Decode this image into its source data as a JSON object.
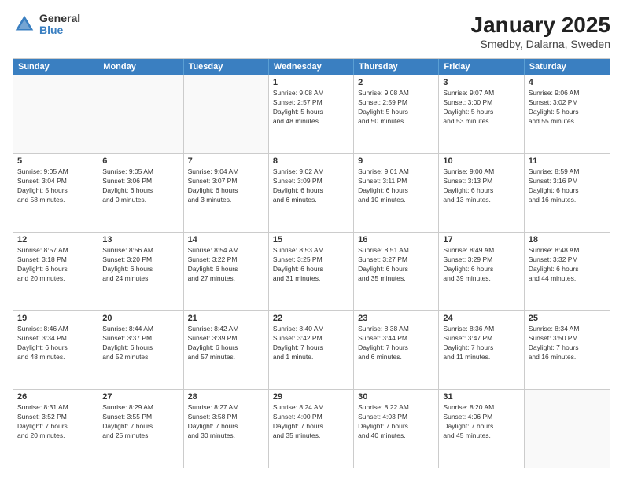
{
  "header": {
    "logo_general": "General",
    "logo_blue": "Blue",
    "month_title": "January 2025",
    "location": "Smedby, Dalarna, Sweden"
  },
  "weekdays": [
    "Sunday",
    "Monday",
    "Tuesday",
    "Wednesday",
    "Thursday",
    "Friday",
    "Saturday"
  ],
  "rows": [
    [
      {
        "day": "",
        "info": "",
        "empty": true
      },
      {
        "day": "",
        "info": "",
        "empty": true
      },
      {
        "day": "",
        "info": "",
        "empty": true
      },
      {
        "day": "1",
        "info": "Sunrise: 9:08 AM\nSunset: 2:57 PM\nDaylight: 5 hours\nand 48 minutes."
      },
      {
        "day": "2",
        "info": "Sunrise: 9:08 AM\nSunset: 2:59 PM\nDaylight: 5 hours\nand 50 minutes."
      },
      {
        "day": "3",
        "info": "Sunrise: 9:07 AM\nSunset: 3:00 PM\nDaylight: 5 hours\nand 53 minutes."
      },
      {
        "day": "4",
        "info": "Sunrise: 9:06 AM\nSunset: 3:02 PM\nDaylight: 5 hours\nand 55 minutes."
      }
    ],
    [
      {
        "day": "5",
        "info": "Sunrise: 9:05 AM\nSunset: 3:04 PM\nDaylight: 5 hours\nand 58 minutes."
      },
      {
        "day": "6",
        "info": "Sunrise: 9:05 AM\nSunset: 3:06 PM\nDaylight: 6 hours\nand 0 minutes."
      },
      {
        "day": "7",
        "info": "Sunrise: 9:04 AM\nSunset: 3:07 PM\nDaylight: 6 hours\nand 3 minutes."
      },
      {
        "day": "8",
        "info": "Sunrise: 9:02 AM\nSunset: 3:09 PM\nDaylight: 6 hours\nand 6 minutes."
      },
      {
        "day": "9",
        "info": "Sunrise: 9:01 AM\nSunset: 3:11 PM\nDaylight: 6 hours\nand 10 minutes."
      },
      {
        "day": "10",
        "info": "Sunrise: 9:00 AM\nSunset: 3:13 PM\nDaylight: 6 hours\nand 13 minutes."
      },
      {
        "day": "11",
        "info": "Sunrise: 8:59 AM\nSunset: 3:16 PM\nDaylight: 6 hours\nand 16 minutes."
      }
    ],
    [
      {
        "day": "12",
        "info": "Sunrise: 8:57 AM\nSunset: 3:18 PM\nDaylight: 6 hours\nand 20 minutes."
      },
      {
        "day": "13",
        "info": "Sunrise: 8:56 AM\nSunset: 3:20 PM\nDaylight: 6 hours\nand 24 minutes."
      },
      {
        "day": "14",
        "info": "Sunrise: 8:54 AM\nSunset: 3:22 PM\nDaylight: 6 hours\nand 27 minutes."
      },
      {
        "day": "15",
        "info": "Sunrise: 8:53 AM\nSunset: 3:25 PM\nDaylight: 6 hours\nand 31 minutes."
      },
      {
        "day": "16",
        "info": "Sunrise: 8:51 AM\nSunset: 3:27 PM\nDaylight: 6 hours\nand 35 minutes."
      },
      {
        "day": "17",
        "info": "Sunrise: 8:49 AM\nSunset: 3:29 PM\nDaylight: 6 hours\nand 39 minutes."
      },
      {
        "day": "18",
        "info": "Sunrise: 8:48 AM\nSunset: 3:32 PM\nDaylight: 6 hours\nand 44 minutes."
      }
    ],
    [
      {
        "day": "19",
        "info": "Sunrise: 8:46 AM\nSunset: 3:34 PM\nDaylight: 6 hours\nand 48 minutes."
      },
      {
        "day": "20",
        "info": "Sunrise: 8:44 AM\nSunset: 3:37 PM\nDaylight: 6 hours\nand 52 minutes."
      },
      {
        "day": "21",
        "info": "Sunrise: 8:42 AM\nSunset: 3:39 PM\nDaylight: 6 hours\nand 57 minutes."
      },
      {
        "day": "22",
        "info": "Sunrise: 8:40 AM\nSunset: 3:42 PM\nDaylight: 7 hours\nand 1 minute."
      },
      {
        "day": "23",
        "info": "Sunrise: 8:38 AM\nSunset: 3:44 PM\nDaylight: 7 hours\nand 6 minutes."
      },
      {
        "day": "24",
        "info": "Sunrise: 8:36 AM\nSunset: 3:47 PM\nDaylight: 7 hours\nand 11 minutes."
      },
      {
        "day": "25",
        "info": "Sunrise: 8:34 AM\nSunset: 3:50 PM\nDaylight: 7 hours\nand 16 minutes."
      }
    ],
    [
      {
        "day": "26",
        "info": "Sunrise: 8:31 AM\nSunset: 3:52 PM\nDaylight: 7 hours\nand 20 minutes."
      },
      {
        "day": "27",
        "info": "Sunrise: 8:29 AM\nSunset: 3:55 PM\nDaylight: 7 hours\nand 25 minutes."
      },
      {
        "day": "28",
        "info": "Sunrise: 8:27 AM\nSunset: 3:58 PM\nDaylight: 7 hours\nand 30 minutes."
      },
      {
        "day": "29",
        "info": "Sunrise: 8:24 AM\nSunset: 4:00 PM\nDaylight: 7 hours\nand 35 minutes."
      },
      {
        "day": "30",
        "info": "Sunrise: 8:22 AM\nSunset: 4:03 PM\nDaylight: 7 hours\nand 40 minutes."
      },
      {
        "day": "31",
        "info": "Sunrise: 8:20 AM\nSunset: 4:06 PM\nDaylight: 7 hours\nand 45 minutes."
      },
      {
        "day": "",
        "info": "",
        "empty": true
      }
    ]
  ]
}
